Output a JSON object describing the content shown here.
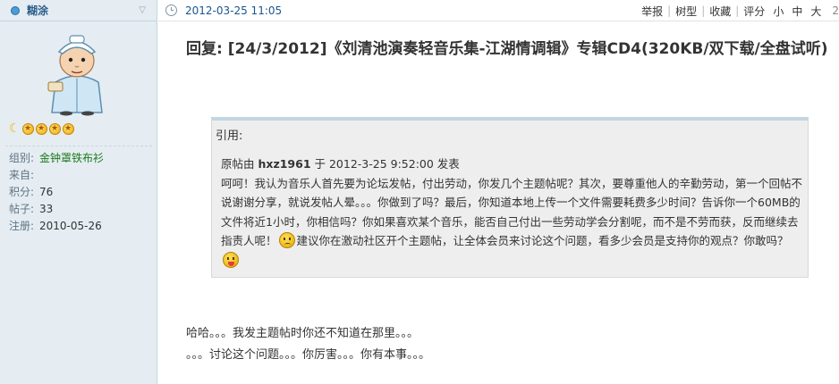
{
  "user": {
    "name": "糊涂",
    "stars": 4,
    "info": [
      {
        "label": "组别:",
        "value": "金钟罩铁布衫"
      },
      {
        "label": "来自:",
        "value": ""
      },
      {
        "label": "积分:",
        "value": "76"
      },
      {
        "label": "帖子:",
        "value": "33"
      },
      {
        "label": "注册:",
        "value": "2010-05-26"
      }
    ]
  },
  "post": {
    "time": "2012-03-25 11:05",
    "actions": {
      "report": "举报",
      "tree": "树型",
      "favorite": "收藏",
      "rate": "评分",
      "small": "小",
      "medium": "中",
      "large": "大",
      "edge": "2"
    },
    "title": "回复: [24/3/2012]《刘清池演奏轻音乐集-江湖情调辑》专辑CD4(320KB/双下载/全盘试听)",
    "quote": {
      "label": "引用:",
      "author_prefix": "原帖由 ",
      "author": "hxz1961",
      "author_suffix": " 于 2012-3-25 9:52:00 发表",
      "text1": "呵呵！我认为音乐人首先要为论坛发帖，付出劳动，你发几个主题帖呢？其次，要尊重他人的辛勤劳动，第一个回帖不说谢谢分享，就说发帖人晕。。。你做到了吗？最后，你知道本地上传一个文件需要耗费多少时间？告诉你一个60MB的文件将近1小时，你相信吗？你如果喜欢某个音乐，能否自己付出一些劳动学会分割呢，而不是不劳而获，反而继续去指责人呢！",
      "text2": "建议你在激动社区开个主题帖，让全体会员来讨论这个问题，看多少会员是支持你的观点？你敢吗？"
    },
    "reply_lines": [
      "哈哈。。。我发主题帖时你还不知道在那里。。。",
      "。。。讨论这个问题。。。你厉害。。。你有本事。。。"
    ]
  },
  "icons": {
    "avatar": "cartoon-monk-avatar",
    "rank_moon": "moon-rank-icon",
    "rank_star": "star-rank-icon",
    "time": "clock-icon",
    "emoticon_sad": "sad-face-emoticon",
    "emoticon_tongue": "tongue-face-emoticon"
  },
  "colors": {
    "sidebar_bg": "#e5edf2",
    "link_blue": "#1a5590",
    "quote_bg": "#eeeeee",
    "group_green": "#1c7a1c"
  }
}
